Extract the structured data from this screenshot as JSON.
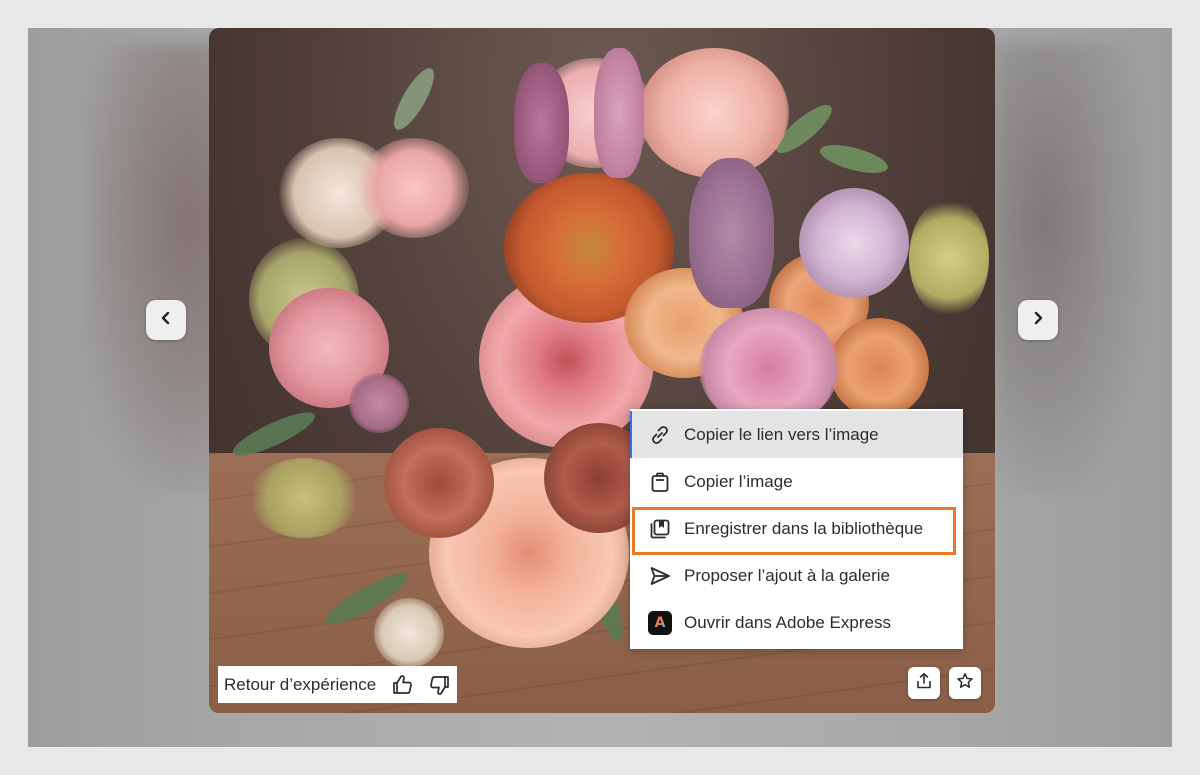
{
  "navigation": {
    "prev_icon": "chevron-left-icon",
    "next_icon": "chevron-right-icon"
  },
  "context_menu": {
    "items": [
      {
        "label": "Copier le lien vers l’image",
        "icon": "link-icon"
      },
      {
        "label": "Copier l’image",
        "icon": "clipboard-icon"
      },
      {
        "label": "Enregistrer dans la bibliothèque",
        "icon": "library-icon"
      },
      {
        "label": "Proposer l’ajout à la galerie",
        "icon": "send-icon"
      },
      {
        "label": "Ouvrir dans Adobe Express",
        "icon": "adobe-express-icon"
      }
    ],
    "active_index": 0,
    "highlighted_index": 2,
    "highlight_color": "#e8782a",
    "active_bar_color": "#3b6fd6"
  },
  "feedback": {
    "label": "Retour d’expérience",
    "like_icon": "thumbs-up-icon",
    "dislike_icon": "thumbs-down-icon"
  },
  "image_actions": {
    "share_icon": "share-icon",
    "favorite_icon": "star-icon"
  }
}
